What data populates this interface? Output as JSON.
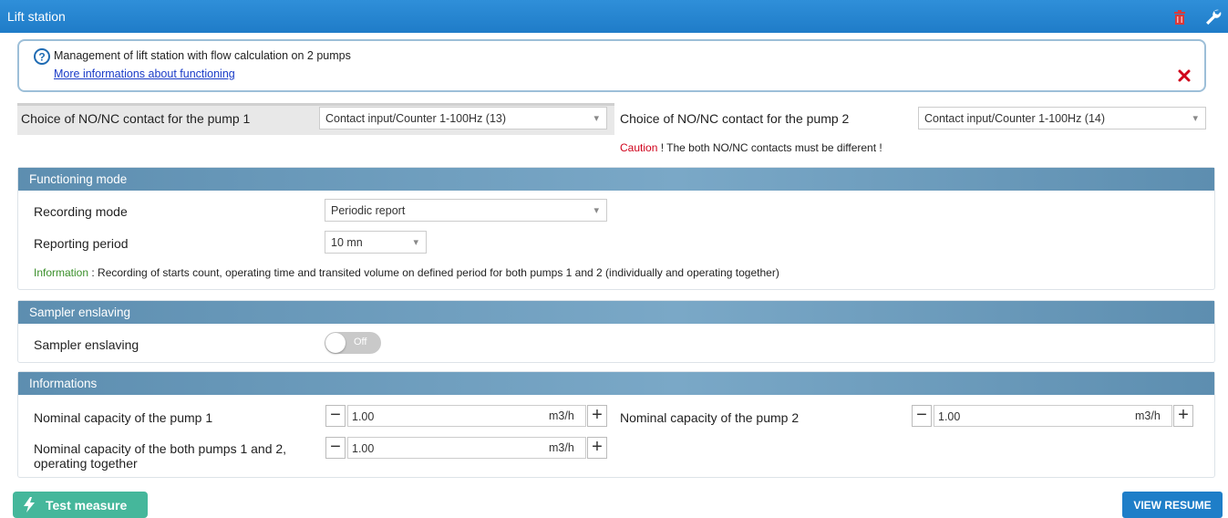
{
  "window": {
    "title": "Lift station"
  },
  "info": {
    "text": "Management of lift station with flow calculation on 2 pumps",
    "link": "More informations about functioning"
  },
  "contacts": {
    "pump1_label": "Choice of NO/NC contact for the pump 1",
    "pump1_value": "Contact input/Counter 1-100Hz (13)",
    "pump2_label": "Choice of NO/NC contact for the pump 2",
    "pump2_value": "Contact input/Counter 1-100Hz (14)",
    "caution_word": "Caution",
    "caution_text": " ! The both NO/NC contacts must be different !"
  },
  "functioning": {
    "title": "Functioning mode",
    "recording_label": "Recording mode",
    "recording_value": "Periodic report",
    "period_label": "Reporting period",
    "period_value": "10 mn",
    "info_word": "Information",
    "info_text": " : Recording of starts count, operating time and transited volume on defined period for both pumps 1 and 2 (individually and operating together)"
  },
  "sampler": {
    "title": "Sampler enslaving",
    "label": "Sampler enslaving",
    "toggle_state": "Off"
  },
  "informations": {
    "title": "Informations",
    "pump1_label": "Nominal capacity of the pump 1",
    "pump1_value": "1.00",
    "pump2_label": "Nominal capacity of the pump 2",
    "pump2_value": "1.00",
    "both_label_line1": "Nominal capacity of the both pumps 1 and 2,",
    "both_label_line2": "operating together",
    "both_value": "1.00",
    "unit": "m3/h"
  },
  "footer": {
    "test_label": "Test measure",
    "resume_label": "VIEW RESUME"
  },
  "colors": {
    "title_bar": "#1f7cc8",
    "panel_header": "#6b9bbd",
    "caution": "#d0021b",
    "info_green": "#3a8f2a",
    "test_button": "#45b79b",
    "resume_button": "#1e7ec8"
  },
  "icons": [
    "trash-icon",
    "wrench-icon",
    "question-circle-icon",
    "close-icon",
    "lightning-bolt-icon",
    "minus-icon",
    "plus-icon"
  ]
}
